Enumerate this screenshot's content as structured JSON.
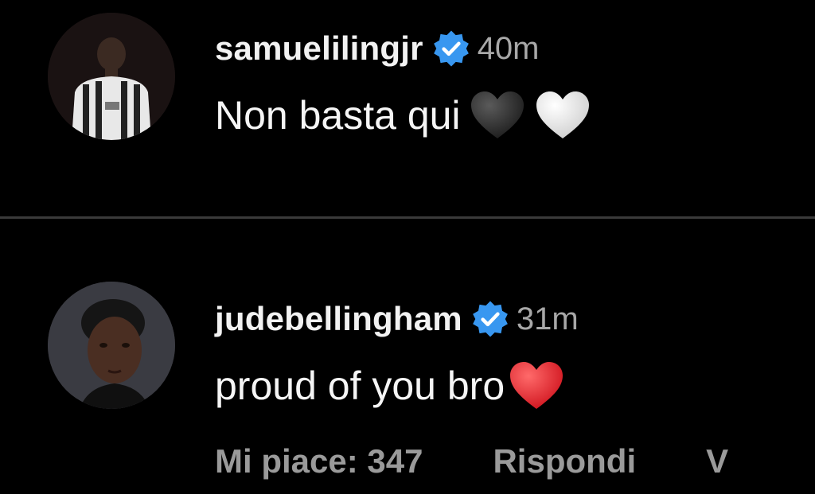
{
  "comments": [
    {
      "username": "samuelilingjr",
      "verified": true,
      "time": "40m",
      "text": "Non basta qui",
      "hearts": [
        "black-heart",
        "white-heart"
      ]
    },
    {
      "username": "judebellingham",
      "verified": true,
      "time": "31m",
      "text": "proud of you bro",
      "hearts": [
        "red-heart"
      ]
    }
  ],
  "actions": {
    "likes_label": "Mi piace: 347",
    "reply_label": "Rispondi",
    "more_label": "V"
  },
  "colors": {
    "background": "#000000",
    "verified_badge": "#3897f0",
    "secondary_text": "#a8a8a8",
    "heart_red": "#e0202a"
  }
}
